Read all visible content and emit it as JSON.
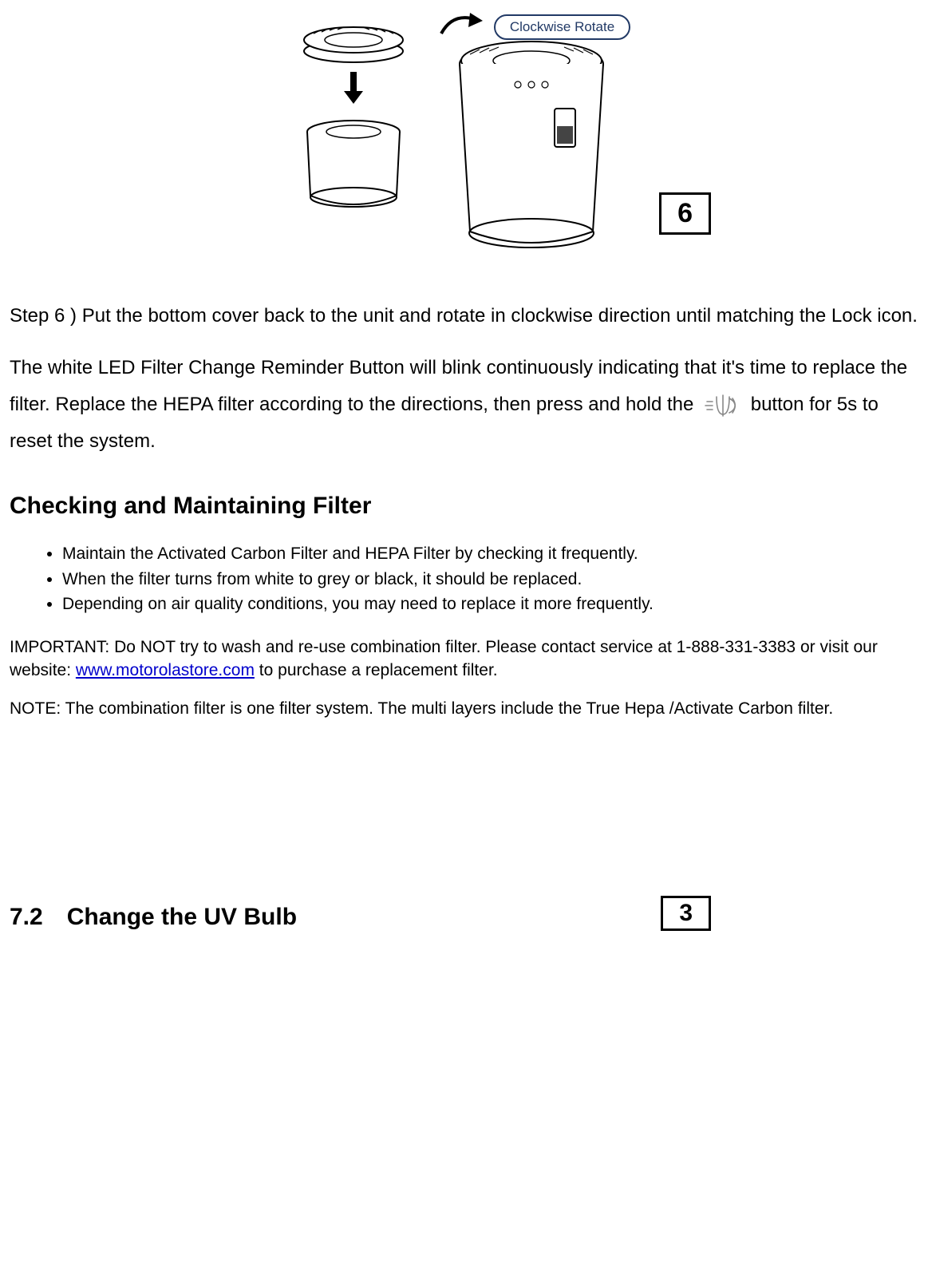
{
  "figure": {
    "step_box": "6",
    "rotate_label": "Clockwise Rotate"
  },
  "step6_text": "Step 6 ) Put the bottom cover back to the unit and rotate in clockwise direction until matching the Lock icon.",
  "reminder": {
    "part1": "The white LED Filter Change Reminder Button will blink continuously indicating that it's time to replace the filter. Replace the HEPA filter according to the directions, then press and hold the",
    "part2": "button for 5s to reset the system."
  },
  "section_title": "Checking and Maintaining Filter",
  "bullets": [
    "Maintain the Activated Carbon Filter and HEPA Filter by checking it frequently.",
    "When the filter turns from white to grey or black, it should be replaced.",
    "Depending on air quality conditions, you may need to replace it more frequently."
  ],
  "important": {
    "pre": "IMPORTANT: Do NOT try to wash and re-use combination filter. Please contact service at 1-888-331-3383 or visit our website: ",
    "link_text": "www.motorolastore.com",
    "post": " to purchase a replacement filter."
  },
  "note_text": "NOTE: The combination filter is one filter system. The multi layers include the True Hepa /Activate Carbon filter.",
  "sub_section_title": "7.2 Change the UV Bulb",
  "page_number": "3"
}
